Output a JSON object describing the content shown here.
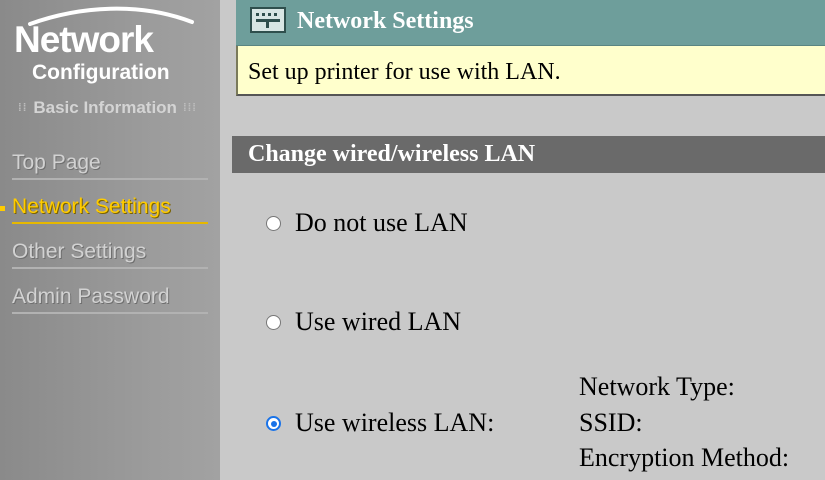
{
  "sidebar": {
    "logo_title": "Network",
    "logo_subtitle": "Configuration",
    "section_label": "Basic Information",
    "items": [
      {
        "label": "Top Page",
        "active": false
      },
      {
        "label": "Network Settings",
        "active": true
      },
      {
        "label": "Other Settings",
        "active": false
      },
      {
        "label": "Admin Password",
        "active": false
      }
    ]
  },
  "header": {
    "title": "Network Settings",
    "icon": "network-settings-icon",
    "description": "Set up printer for use with LAN."
  },
  "section": {
    "title": "Change wired/wireless LAN",
    "options": [
      {
        "label": "Do not use LAN",
        "checked": false
      },
      {
        "label": "Use wired LAN",
        "checked": false
      },
      {
        "label": "Use wireless LAN:",
        "checked": true
      }
    ],
    "wireless_info": {
      "network_type_label": "Network Type:",
      "ssid_label": "SSID:",
      "encryption_label": "Encryption Method:"
    }
  },
  "colors": {
    "sidebar_bg": "#9a9a9a",
    "active_nav": "#ffcc00",
    "header_bg": "#6e9e9b",
    "description_bg": "#ffffcc",
    "section_header_bg": "#6a6a6a",
    "content_bg": "#c9c9c9",
    "radio_checked": "#1a73e8"
  }
}
